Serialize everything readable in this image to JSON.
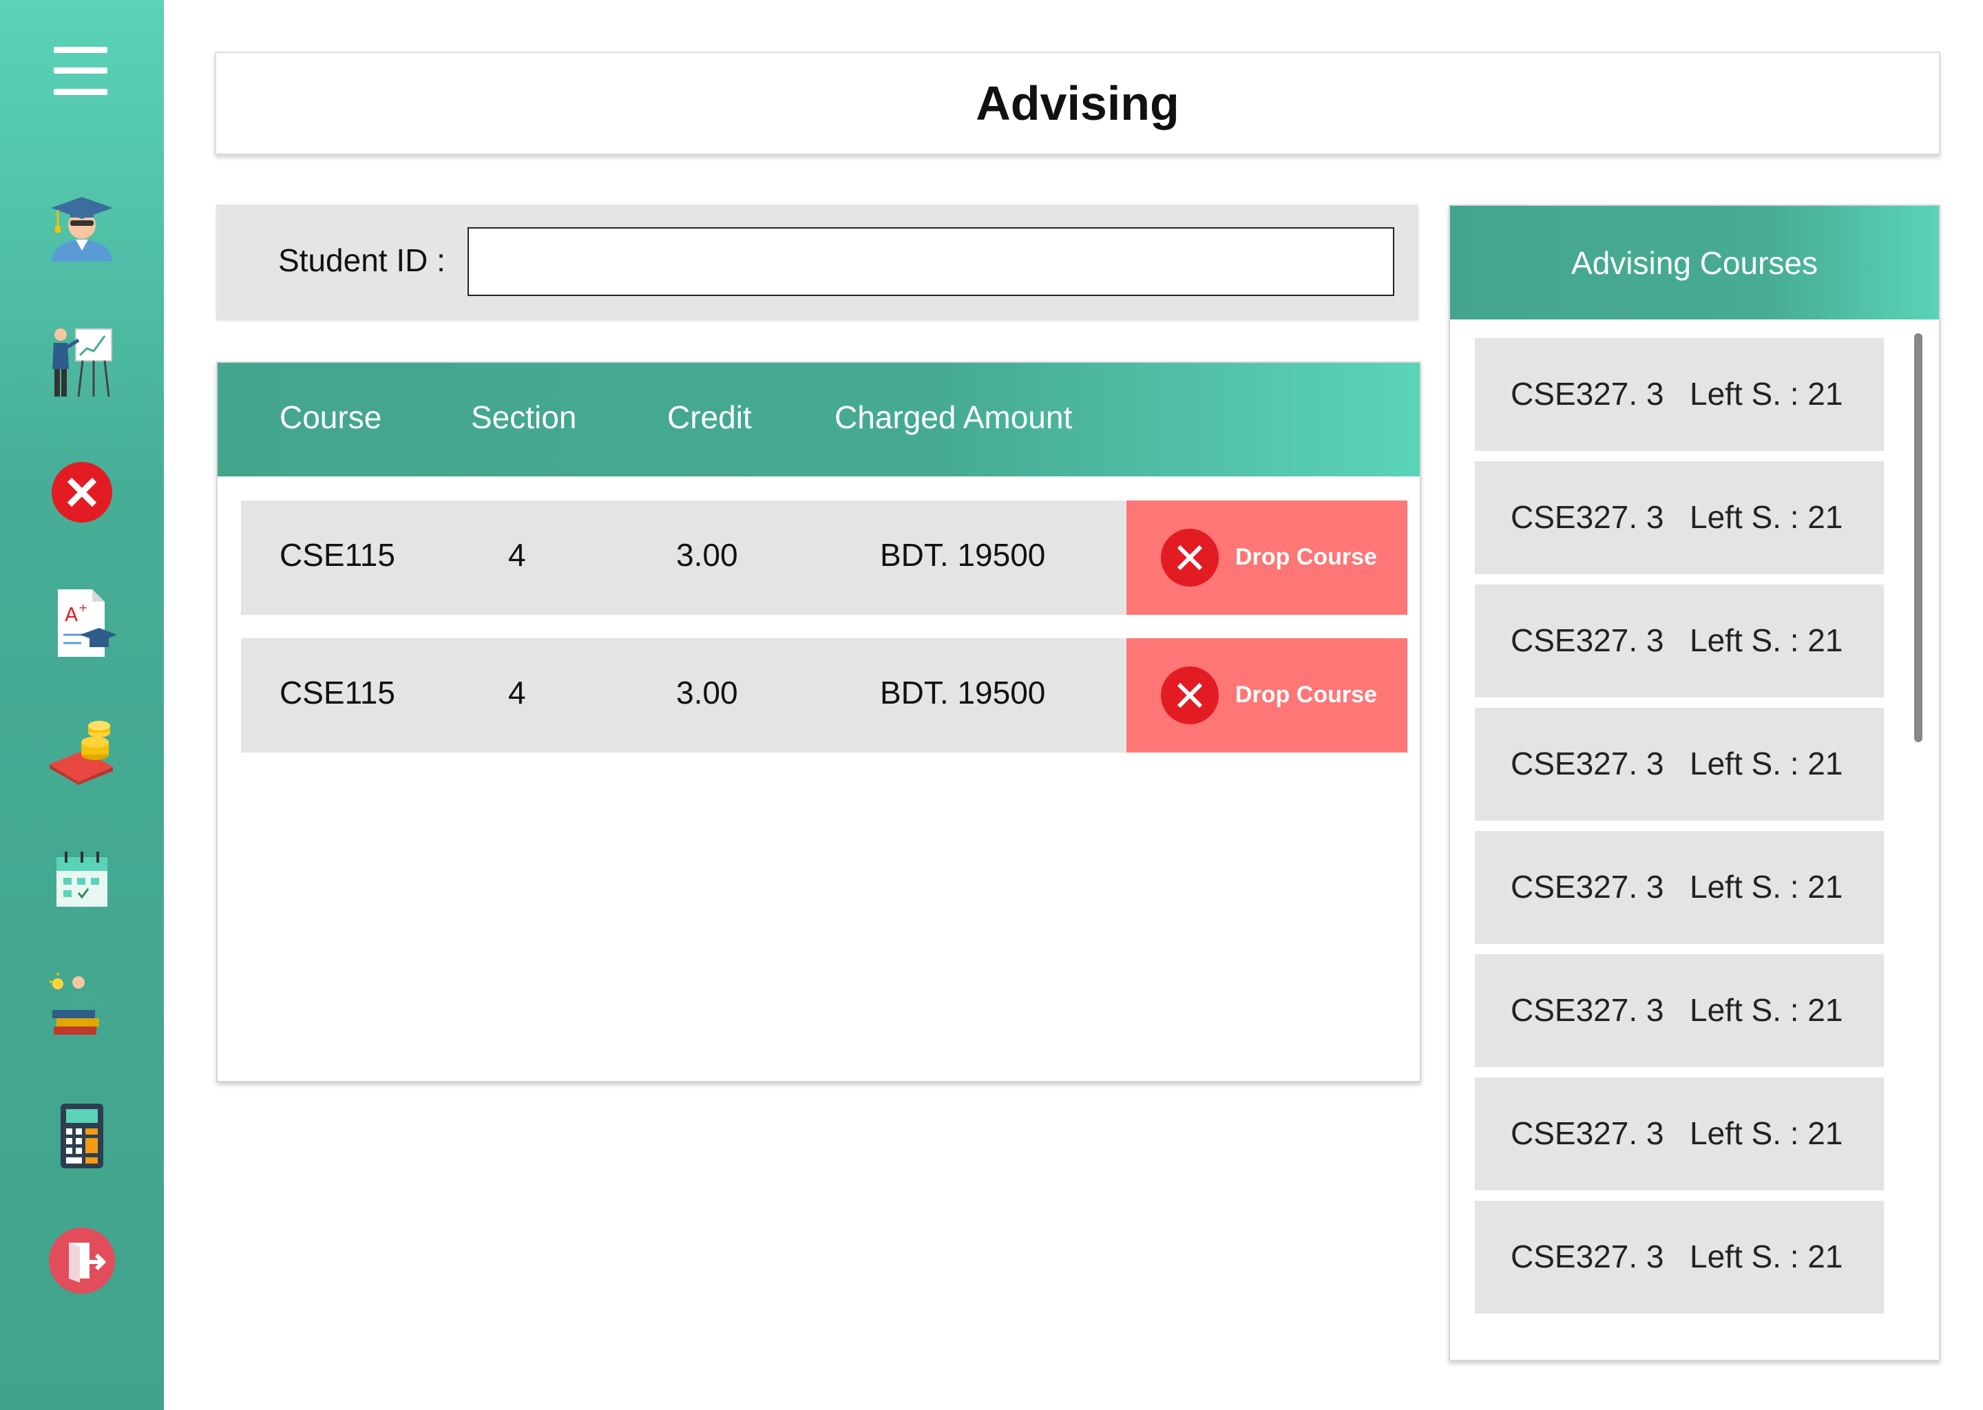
{
  "header": {
    "title": "Advising"
  },
  "sidebar": {
    "icons": [
      "student-icon",
      "teacher-board-icon",
      "cancel-icon",
      "grade-report-icon",
      "payment-icon",
      "calendar-icon",
      "study-books-icon",
      "calculator-icon",
      "logout-icon"
    ]
  },
  "student": {
    "label": "Student ID :",
    "value": "",
    "placeholder": ""
  },
  "table": {
    "headers": {
      "course": "Course",
      "section": "Section",
      "credit": "Credit",
      "charged": "Charged Amount"
    },
    "rows": [
      {
        "course": "CSE115",
        "section": "4",
        "credit": "3.00",
        "amount": "BDT. 19500",
        "action": "Drop Course"
      },
      {
        "course": "CSE115",
        "section": "4",
        "credit": "3.00",
        "amount": "BDT. 19500",
        "action": "Drop Course"
      }
    ]
  },
  "advising": {
    "title": "Advising Courses",
    "courses": [
      {
        "code": "CSE327. 3",
        "left": "Left S. : 21"
      },
      {
        "code": "CSE327. 3",
        "left": "Left S. : 21"
      },
      {
        "code": "CSE327. 3",
        "left": "Left S. : 21"
      },
      {
        "code": "CSE327. 3",
        "left": "Left S. : 21"
      },
      {
        "code": "CSE327. 3",
        "left": "Left S. : 21"
      },
      {
        "code": "CSE327. 3",
        "left": "Left S. : 21"
      },
      {
        "code": "CSE327. 3",
        "left": "Left S. : 21"
      },
      {
        "code": "CSE327. 3",
        "left": "Left S. : 21"
      }
    ]
  },
  "colors": {
    "accent": "#46aa92",
    "accent_light": "#5ad3b8",
    "drop": "#fe7676",
    "drop_icon": "#e31b23"
  }
}
